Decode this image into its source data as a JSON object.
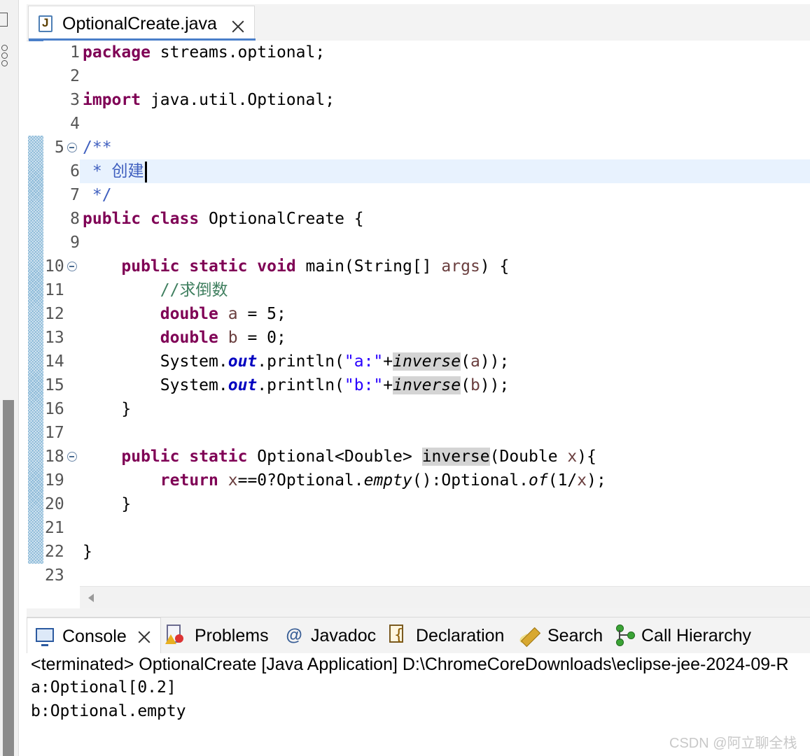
{
  "editor": {
    "tab_title": "OptionalCreate.java",
    "line_numbers": [
      "1",
      "2",
      "3",
      "4",
      "5",
      "6",
      "7",
      "8",
      "9",
      "10",
      "11",
      "12",
      "13",
      "14",
      "15",
      "16",
      "17",
      "18",
      "19",
      "20",
      "21",
      "22",
      "23"
    ],
    "code": {
      "l1": {
        "kw": "package",
        "rest": " streams.optional;"
      },
      "l3": {
        "kw": "import",
        "rest": " java.util.Optional;"
      },
      "l5": "/**",
      "l6": " * 创建",
      "l7": " */",
      "l8": {
        "kw1": "public",
        "kw2": "class",
        "rest": " OptionalCreate {"
      },
      "l10": {
        "indent": "    ",
        "kw1": "public",
        "kw2": "static",
        "kw3": "void",
        "rest1": " main(String[] ",
        "param": "args",
        "rest2": ") {"
      },
      "l11": {
        "indent": "        ",
        "comment": "//求倒数"
      },
      "l12": {
        "indent": "        ",
        "kw": "double",
        "var": "a",
        "rest": " = 5;"
      },
      "l13": {
        "indent": "        ",
        "kw": "double",
        "var": "b",
        "rest": " = 0;"
      },
      "l14": {
        "indent": "        ",
        "p1": "System.",
        "field": "out",
        "p2": ".println(",
        "str": "\"a:\"",
        "p3": "+",
        "call": "inverse",
        "p4": "(",
        "var": "a",
        "p5": "));"
      },
      "l15": {
        "indent": "        ",
        "p1": "System.",
        "field": "out",
        "p2": ".println(",
        "str": "\"b:\"",
        "p3": "+",
        "call": "inverse",
        "p4": "(",
        "var": "b",
        "p5": "));"
      },
      "l16": "    }",
      "l18": {
        "indent": "    ",
        "kw1": "public",
        "kw2": "static",
        "p1": " Optional<Double> ",
        "decl": "inverse",
        "p2": "(Double ",
        "param": "x",
        "p3": "){"
      },
      "l19": {
        "indent": "        ",
        "kw": "return",
        "var1": "x",
        "p1": "==0?Optional.",
        "m1": "empty",
        "p2": "():Optional.",
        "m2": "of",
        "p3": "(1/",
        "var2": "x",
        "p4": ");"
      },
      "l20": "    }",
      "l22": "}"
    }
  },
  "views": {
    "tabs": [
      {
        "label": "Console",
        "icon": "console-icon",
        "active": true
      },
      {
        "label": "Problems",
        "icon": "problems-icon"
      },
      {
        "label": "Javadoc",
        "icon": "javadoc-at-icon"
      },
      {
        "label": "Declaration",
        "icon": "declaration-icon"
      },
      {
        "label": "Search",
        "icon": "search-icon"
      },
      {
        "label": "Call Hierarchy",
        "icon": "call-hierarchy-icon"
      }
    ],
    "javadoc_symbol": "@"
  },
  "console": {
    "terminated": "<terminated> OptionalCreate [Java Application] D:\\ChromeCoreDownloads\\eclipse-jee-2024-09-R",
    "output": [
      "a:Optional[0.2]",
      "b:Optional.empty"
    ]
  },
  "watermark": "CSDN @阿立聊全栈"
}
